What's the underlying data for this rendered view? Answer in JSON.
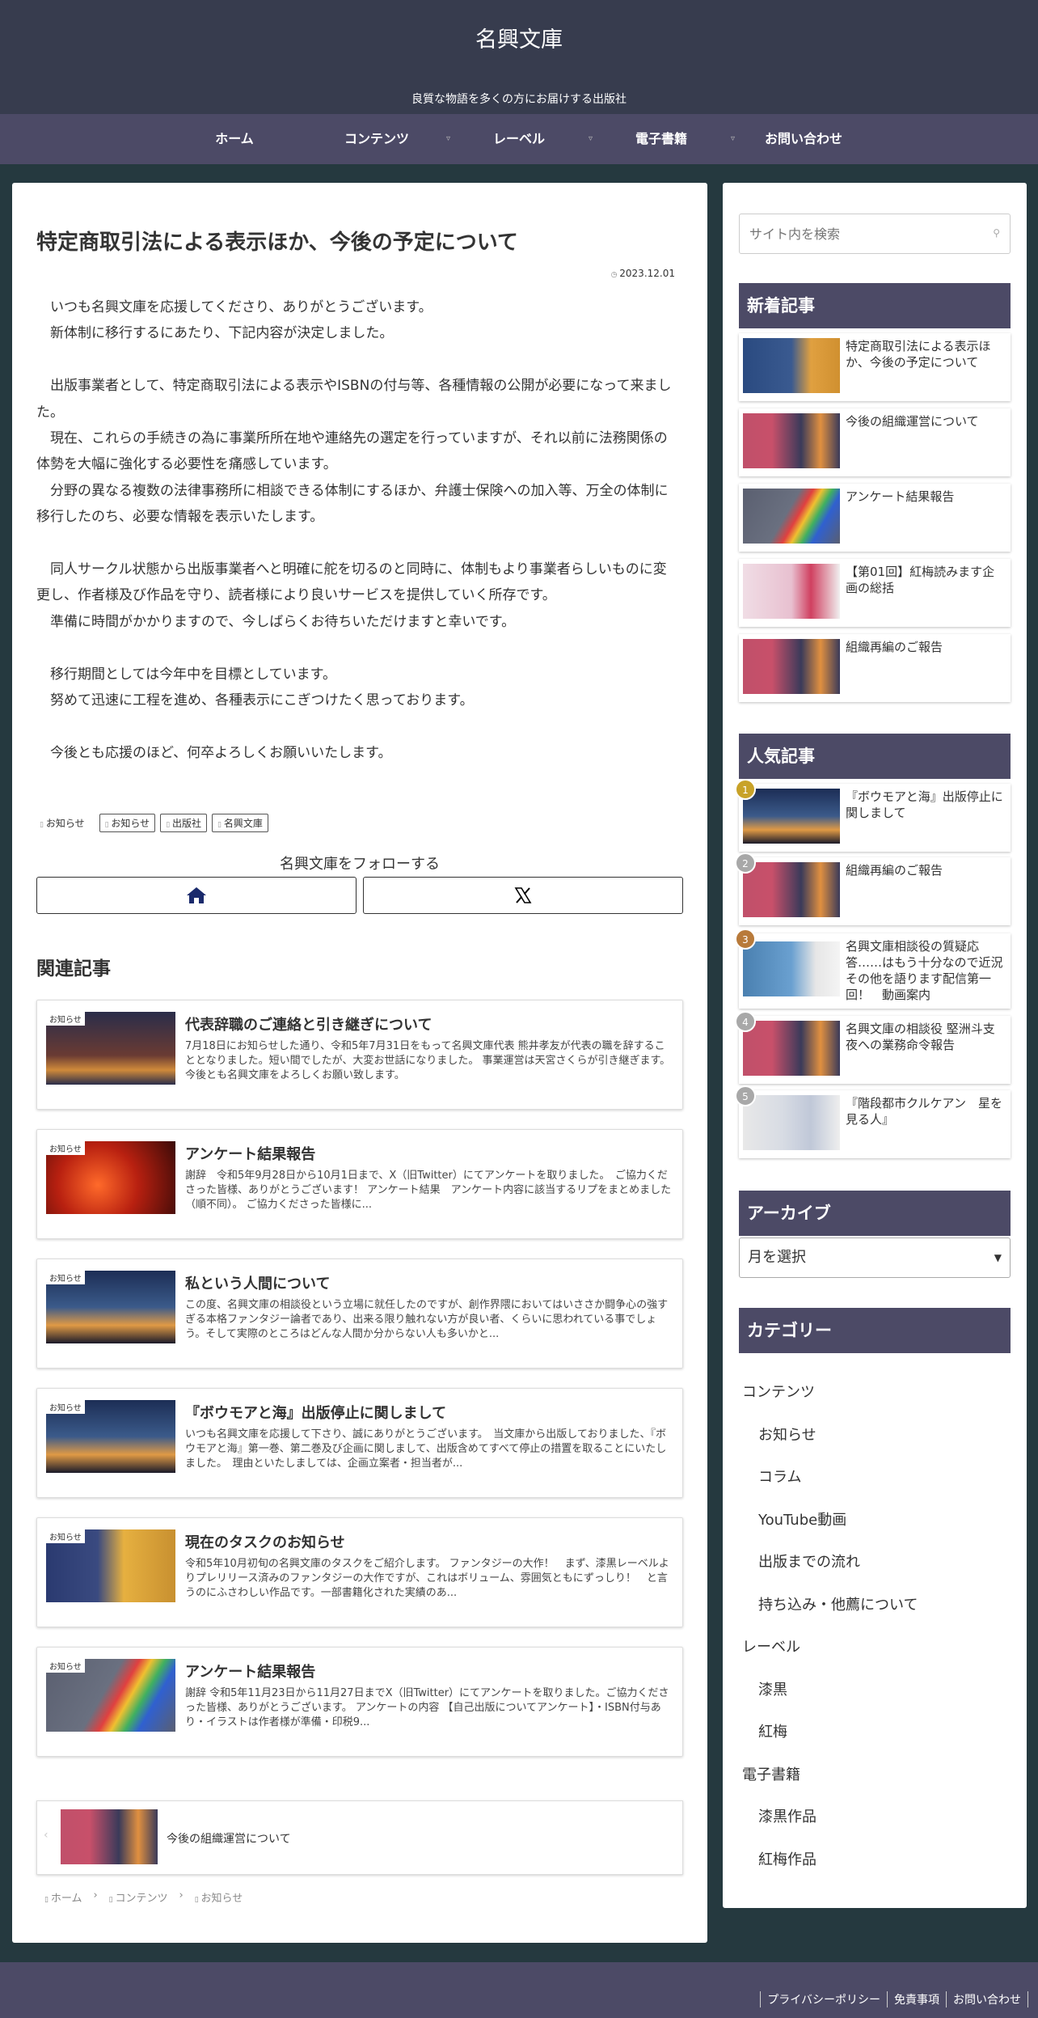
{
  "site": {
    "title": "名興文庫",
    "tagline": "良質な物語を多くの方にお届けする出版社"
  },
  "nav": {
    "items": [
      "ホーム",
      "コンテンツ",
      "レーベル",
      "電子書籍",
      "お問い合わせ"
    ]
  },
  "article": {
    "title": "特定商取引法による表示ほか、今後の予定について",
    "date": "2023.12.01",
    "paragraphs": [
      "　いつも名興文庫を応援してくださり、ありがとうございます。",
      "　新体制に移行するにあたり、下記内容が決定しました。",
      "",
      "　出版事業者として、特定商取引法による表示やISBNの付与等、各種情報の公開が必要になって来ました。",
      "　現在、これらの手続きの為に事業所所在地や連絡先の選定を行っていますが、それ以前に法務関係の体勢を大幅に強化する必要性を痛感しています。",
      "　分野の異なる複数の法律事務所に相談できる体制にするほか、弁護士保険への加入等、万全の体制に移行したのち、必要な情報を表示いたします。",
      "",
      "　同人サークル状態から出版事業者へと明確に舵を切るのと同時に、体制もより事業者らしいものに変更し、作者様及び作品を守り、読者様により良いサービスを提供していく所存です。",
      "　準備に時間がかかりますので、今しばらくお待ちいただけますと幸いです。",
      "",
      "　移行期間としては今年中を目標としています。",
      "　努めて迅速に工程を進め、各種表示にこぎつけたく思っております。",
      "",
      "　今後とも応援のほど、何卒よろしくお願いいたします。"
    ],
    "category": "お知らせ",
    "tags": [
      "お知らせ",
      "出版社",
      "名興文庫"
    ]
  },
  "follow": {
    "label": "名興文庫をフォローする"
  },
  "related": {
    "heading": "関連記事",
    "items": [
      {
        "category": "お知らせ",
        "title": "代表辞職のご連絡と引き継ぎについて",
        "desc": "7月18日にお知らせした通り、令和5年7月31日をもって名興文庫代表 熊井孝友が代表の職を辞することとなりました。短い間でしたが、大変お世話になりました。 事業運営は天宮さくらが引き継ぎます。今後とも名興文庫をよろしくお願い致します。"
      },
      {
        "category": "お知らせ",
        "title": "アンケート結果報告",
        "desc": "謝辞　令和5年9月28日から10月1日まで、X（旧Twitter）にてアンケートを取りました。　ご協力くださった皆様、ありがとうございます！ アンケート結果　アンケート内容に該当するリプをまとめました（順不同）。 ご協力くださった皆様に..."
      },
      {
        "category": "お知らせ",
        "title": "私という人間について",
        "desc": "この度、名興文庫の相談役という立場に就任したのですが、創作界隈においてはいささか闘争心の強すぎる本格ファンタジー論者であり、出来る限り触れない方が良い者、くらいに思われている事でしょう。そして実際のところはどんな人間か分からない人も多いかと..."
      },
      {
        "category": "お知らせ",
        "title": "『ボウモアと海』出版停止に関しまして",
        "desc": "いつも名興文庫を応援して下さり、誠にありがとうございます。　当文庫から出版しておりました、『ボウモアと海』第一巻、第二巻及び企画に関しまして、出版含めてすべて停止の措置を取ることにいたしました。　理由といたしましては、企画立案者・担当者が..."
      },
      {
        "category": "お知らせ",
        "title": "現在のタスクのお知らせ",
        "desc": "令和5年10月初旬の名興文庫のタスクをご紹介します。 ファンタジーの大作！　まず、漆黒レーベルよりプレリリース済みのファンタジーの大作ですが、これはボリューム、雰囲気ともにずっしり！　と言うのにふさわしい作品です。一部書籍化された実績のあ..."
      },
      {
        "category": "お知らせ",
        "title": "アンケート結果報告",
        "desc": "謝辞 令和5年11月23日から11月27日までX（旧Twitter）にてアンケートを取りました。ご協力くださった皆様、ありがとうございます。 アンケートの内容 【自己出版についてアンケート】・ISBN付与あり・イラストは作者様が準備・印税9..."
      }
    ]
  },
  "prev_post": {
    "title": "今後の組織運営について"
  },
  "breadcrumb": [
    "ホーム",
    "コンテンツ",
    "お知らせ"
  ],
  "sidebar": {
    "search_placeholder": "サイト内を検索",
    "new_heading": "新着記事",
    "new_items": [
      "特定商取引法による表示ほか、今後の予定について",
      "今後の組織運営について",
      "アンケート結果報告",
      "【第01回】紅梅読みます企画の総括",
      "組織再編のご報告"
    ],
    "popular_heading": "人気記事",
    "popular_items": [
      {
        "rank": "1",
        "title": "『ボウモアと海』出版停止に関しまして"
      },
      {
        "rank": "2",
        "title": "組織再編のご報告"
      },
      {
        "rank": "3",
        "title": "名興文庫相談役の質疑応答……はもう十分なので近況その他を語ります配信第一回！　動画案内"
      },
      {
        "rank": "4",
        "title": "名興文庫の相談役 堅洲斗支夜への業務命令報告"
      },
      {
        "rank": "5",
        "title": "『階段都市クルケアン　星を見る人』"
      }
    ],
    "archive_heading": "アーカイブ",
    "archive_select": "月を選択",
    "category_heading": "カテゴリー",
    "categories": [
      {
        "label": "コンテンツ",
        "sub": false
      },
      {
        "label": "お知らせ",
        "sub": true
      },
      {
        "label": "コラム",
        "sub": true
      },
      {
        "label": "YouTube動画",
        "sub": true
      },
      {
        "label": "出版までの流れ",
        "sub": true
      },
      {
        "label": "持ち込み・他薦について",
        "sub": true
      },
      {
        "label": "レーベル",
        "sub": false
      },
      {
        "label": "漆黒",
        "sub": true
      },
      {
        "label": "紅梅",
        "sub": true
      },
      {
        "label": "電子書籍",
        "sub": false
      },
      {
        "label": "漆黒作品",
        "sub": true
      },
      {
        "label": "紅梅作品",
        "sub": true
      }
    ]
  },
  "footer": {
    "links": [
      "プライバシーポリシー",
      "免責事項",
      "お問い合わせ"
    ]
  }
}
